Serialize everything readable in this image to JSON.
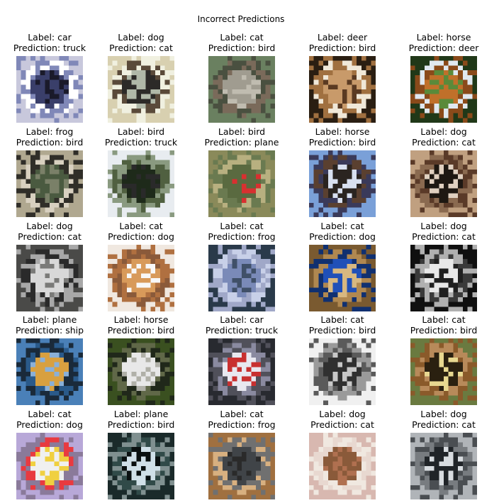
{
  "figure": {
    "title": "Incorrect Predictions",
    "label_prefix": "Label: ",
    "prediction_prefix": "Prediction: "
  },
  "images": [
    {
      "label": "car",
      "prediction": "truck",
      "subject": "car-icon",
      "palette": [
        "#c8c8dc",
        "#3a3f6a",
        "#ffffff",
        "#1a1a2a",
        "#8088b8"
      ]
    },
    {
      "label": "dog",
      "prediction": "cat",
      "subject": "dog-icon",
      "palette": [
        "#d8d0b0",
        "#2c2a28",
        "#5a4a3a",
        "#b0b8a8",
        "#f0f0e0"
      ]
    },
    {
      "label": "cat",
      "prediction": "bird",
      "subject": "cat-icon",
      "palette": [
        "#6a8060",
        "#a09c90",
        "#7a6a5a",
        "#c0bcb0",
        "#4a5040"
      ]
    },
    {
      "label": "deer",
      "prediction": "bird",
      "subject": "deer-icon",
      "palette": [
        "#2a1e12",
        "#c89a6a",
        "#f0e8d8",
        "#5a3a22",
        "#a07040"
      ]
    },
    {
      "label": "horse",
      "prediction": "deer",
      "subject": "horse-icon",
      "palette": [
        "#203818",
        "#c0702a",
        "#e0e8f0",
        "#5a8a3a",
        "#8a4a1a"
      ]
    },
    {
      "label": "frog",
      "prediction": "bird",
      "subject": "frog-icon",
      "palette": [
        "#b0a890",
        "#4a5a40",
        "#d8d0c0",
        "#7a8068",
        "#302e28"
      ]
    },
    {
      "label": "bird",
      "prediction": "truck",
      "subject": "bird-icon",
      "palette": [
        "#e8ecf0",
        "#1e2a1a",
        "#506040",
        "#2a2a2a",
        "#8a9a80"
      ]
    },
    {
      "label": "bird",
      "prediction": "plane",
      "subject": "bird-icon",
      "palette": [
        "#8a8a5a",
        "#5a6a40",
        "#b8b080",
        "#d83030",
        "#6a7a50"
      ]
    },
    {
      "label": "horse",
      "prediction": "bird",
      "subject": "horse-icon",
      "palette": [
        "#7aa0d8",
        "#2a2420",
        "#5a4030",
        "#d8e0f0",
        "#3a3a5a"
      ]
    },
    {
      "label": "dog",
      "prediction": "cat",
      "subject": "dog-icon",
      "palette": [
        "#c0a080",
        "#1e1812",
        "#8a6a50",
        "#e0d0c0",
        "#5a3a28"
      ]
    },
    {
      "label": "dog",
      "prediction": "cat",
      "subject": "dog-icon",
      "palette": [
        "#4a4a48",
        "#d8d8d8",
        "#2a2a2a",
        "#7a7a78",
        "#a8a8a8"
      ]
    },
    {
      "label": "cat",
      "prediction": "dog",
      "subject": "cat-icon",
      "palette": [
        "#f0e8e0",
        "#d89a5a",
        "#8a5a3a",
        "#f8f8f8",
        "#b07040"
      ]
    },
    {
      "label": "cat",
      "prediction": "frog",
      "subject": "cat-icon",
      "palette": [
        "#2a3a4a",
        "#7a8ab8",
        "#c8d0e8",
        "#405068",
        "#a0a8c8"
      ]
    },
    {
      "label": "cat",
      "prediction": "dog",
      "subject": "cat-icon",
      "palette": [
        "#7a5a30",
        "#2050b8",
        "#b08850",
        "#d8b880",
        "#103070"
      ]
    },
    {
      "label": "dog",
      "prediction": "cat",
      "subject": "dog-icon",
      "palette": [
        "#101010",
        "#e8e8e8",
        "#3a3a3a",
        "#202020",
        "#b0b0b0"
      ]
    },
    {
      "label": "plane",
      "prediction": "ship",
      "subject": "plane-icon",
      "palette": [
        "#4a80b8",
        "#d8a040",
        "#2a5a8a",
        "#8ab0d8",
        "#1a2a3a"
      ]
    },
    {
      "label": "horse",
      "prediction": "bird",
      "subject": "horse-icon",
      "palette": [
        "#3a5020",
        "#e8e8e8",
        "#606848",
        "#b0b0a8",
        "#20281a"
      ]
    },
    {
      "label": "car",
      "prediction": "truck",
      "subject": "car-icon",
      "palette": [
        "#282a30",
        "#e8e8f0",
        "#8a8aa0",
        "#c83030",
        "#50505a"
      ]
    },
    {
      "label": "cat",
      "prediction": "bird",
      "subject": "cat-icon",
      "palette": [
        "#f0f0f0",
        "#303030",
        "#9a9a9a",
        "#c8c8c8",
        "#5a5a5a"
      ]
    },
    {
      "label": "cat",
      "prediction": "bird",
      "subject": "cat-icon",
      "palette": [
        "#6a7a40",
        "#2a2010",
        "#b88a5a",
        "#e8d890",
        "#8a5a2a"
      ]
    },
    {
      "label": "cat",
      "prediction": "dog",
      "subject": "cat-icon",
      "palette": [
        "#b8a8d8",
        "#f0f0f0",
        "#e83a40",
        "#f0d040",
        "#8a7a9a"
      ]
    },
    {
      "label": "plane",
      "prediction": "bird",
      "subject": "plane-icon",
      "palette": [
        "#1a2a2a",
        "#d0e0e8",
        "#304a48",
        "#0a1010",
        "#809090"
      ]
    },
    {
      "label": "cat",
      "prediction": "frog",
      "subject": "cat-icon",
      "palette": [
        "#a07040",
        "#404448",
        "#d8b080",
        "#2a2a2a",
        "#707070"
      ]
    },
    {
      "label": "dog",
      "prediction": "cat",
      "subject": "dog-icon",
      "palette": [
        "#d8b8b0",
        "#8a5a3a",
        "#e8d8d0",
        "#b07050",
        "#f0e8e0"
      ]
    },
    {
      "label": "dog",
      "prediction": "cat",
      "subject": "dog-icon",
      "palette": [
        "#b0b4b8",
        "#202428",
        "#787c80",
        "#d8dce0",
        "#4a4e52"
      ]
    }
  ]
}
